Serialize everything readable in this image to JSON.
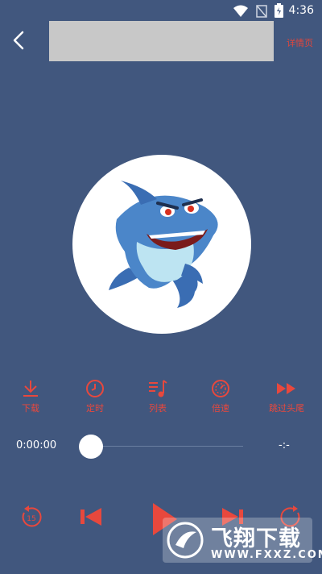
{
  "status_bar": {
    "time": "4:36"
  },
  "header": {
    "detail_link": "详情页"
  },
  "actions": [
    {
      "label": "下载",
      "icon": "download-icon"
    },
    {
      "label": "定时",
      "icon": "clock-icon"
    },
    {
      "label": "列表",
      "icon": "playlist-icon"
    },
    {
      "label": "倍速",
      "icon": "speed-icon"
    },
    {
      "label": "跳过头尾",
      "icon": "skip-intro-icon"
    }
  ],
  "progress": {
    "current": "0:00:00",
    "total": "-:-",
    "fraction": 0
  },
  "controls": {
    "rewind_seconds": "15"
  },
  "watermark": {
    "title": "飞翔下载",
    "url": "WWW.FXXZ.COM"
  },
  "colors": {
    "background": "#41577e",
    "accent": "#e8483d"
  }
}
